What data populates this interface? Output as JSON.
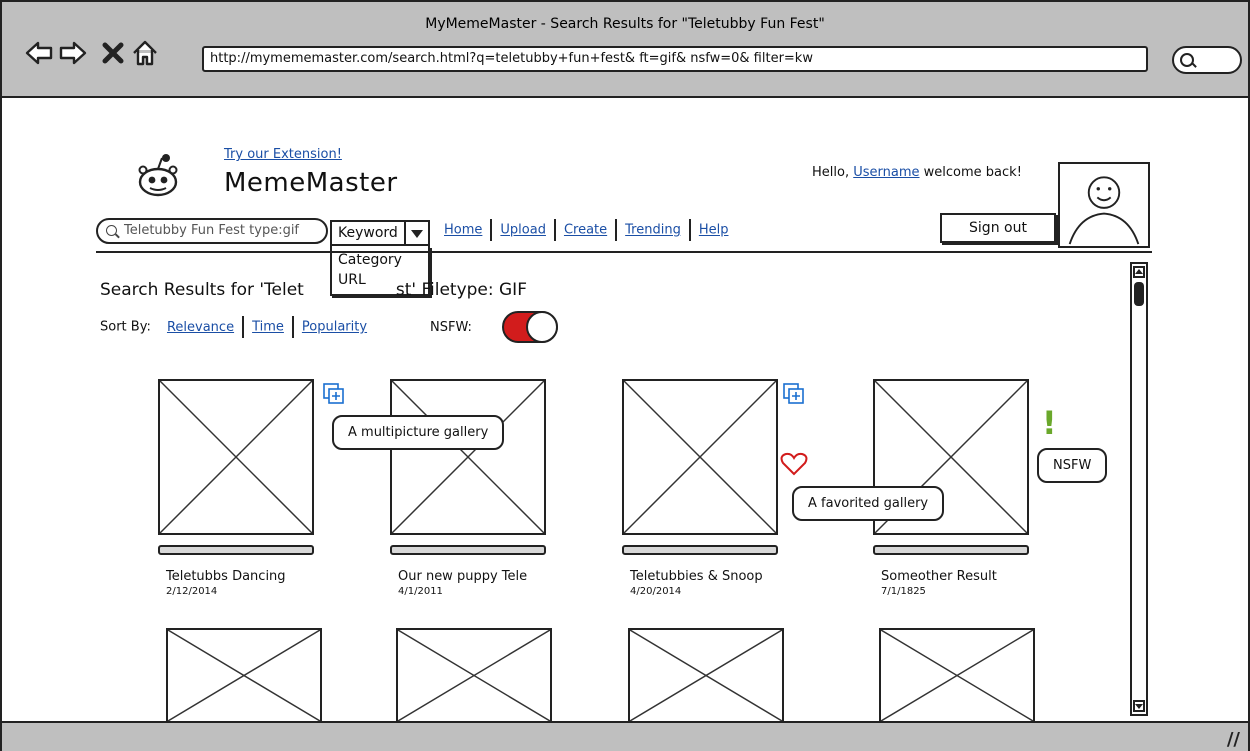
{
  "window": {
    "title": "MyMemeMaster - Search Results for \"Teletubby Fun Fest\"",
    "address": "http://mymememaster.com/search.html?q=teletubby+fun+fest& ft=gif& nsfw=0& filter=kw"
  },
  "header": {
    "try_extension": "Try our Extension!",
    "brand": "MemeMaster",
    "hello_prefix": "Hello,",
    "username": "Username",
    "hello_suffix": "welcome back!",
    "sign_out": "Sign out"
  },
  "search": {
    "value": "Teletubby Fun Fest type:gif",
    "filter_selected": "Keyword",
    "filter_options": [
      "Category",
      "URL"
    ]
  },
  "menu": {
    "items": [
      "Home",
      "Upload",
      "Create",
      "Trending",
      "Help"
    ]
  },
  "results": {
    "title": "Search Results for 'Teletubby Fun Fest' Filetype: GIF",
    "title_left": "Search Results for 'Telet",
    "title_right": "st' Filetype: GIF",
    "sort_label": "Sort By:",
    "sort_options": [
      "Relevance",
      "Time",
      "Popularity"
    ],
    "nsfw_label": "NSFW:",
    "nsfw_enabled": true
  },
  "cards": [
    {
      "title": "Teletubbs Dancing",
      "date": "2/12/2014"
    },
    {
      "title": "Our new puppy Tele",
      "date": "4/1/2011"
    },
    {
      "title": "Teletubbies & Snoop",
      "date": "4/20/2014"
    },
    {
      "title": "Someother Result",
      "date": "7/1/1825"
    }
  ],
  "annotations": {
    "gallery": "A multipicture gallery",
    "favorited": "A favorited gallery",
    "nsfw": "NSFW"
  },
  "colors": {
    "link": "#1a4ea5",
    "toggle_on": "#d21c1c",
    "heart": "#d21c1c",
    "gallery_icon": "#1a6fd0",
    "nsfw_mark": "#6aa82b",
    "chrome": "#bfbfbf"
  }
}
